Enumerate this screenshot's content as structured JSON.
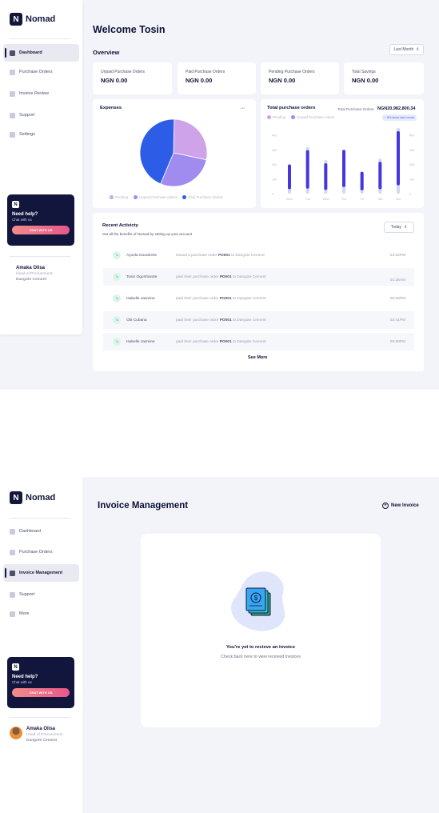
{
  "brand": {
    "name": "Nomad",
    "letter": "N"
  },
  "sidebar1": {
    "items": [
      {
        "label": "Dashboard",
        "active": true
      },
      {
        "label": "Purchase Orders"
      },
      {
        "label": "Invoice Review"
      },
      {
        "label": "Support"
      },
      {
        "label": "Settings"
      }
    ]
  },
  "sidebar2": {
    "items": [
      {
        "label": "Dashboard"
      },
      {
        "label": "Purchase Orders"
      },
      {
        "label": "Invoice Management",
        "active": true
      },
      {
        "label": "Support"
      },
      {
        "label": "More"
      }
    ]
  },
  "help": {
    "letter": "N",
    "title": "Need help?",
    "subtitle": "Chat with us",
    "button": "CHAT WITH US"
  },
  "profile": {
    "name": "Amaka Olisa",
    "role": "Head of Procurement",
    "org": "Dangote Cement"
  },
  "dashboard": {
    "welcome": "Welcome Tosin",
    "overview": "Overview",
    "period": "Last Month",
    "stats": [
      {
        "label": "Unpaid Purchase Orders",
        "value": "NGN 0.00"
      },
      {
        "label": "Paid Purchase Orders",
        "value": "NGN 0.00"
      },
      {
        "label": "Pending Purchase Orders",
        "value": "NGN 0.00"
      },
      {
        "label": "Total Savings",
        "value": "NGN 0.00"
      }
    ],
    "expenses": {
      "title": "Expenses",
      "menu": "•••"
    },
    "totals": {
      "title": "Total purchase orders",
      "sub_label": "Total Purchase Orders",
      "sub_value": "NGN20,982,800.34",
      "badge": "↑ 8% since last month"
    },
    "activity": {
      "title": "Recent Activicty",
      "subtitle": "Get all the benefits of Nomad by setting up your account",
      "filter": "Today",
      "rows": [
        {
          "name": "Ayoola Goodness",
          "pre": "issued a purchase order",
          "code": "PO001",
          "post": "to Dangote Cement",
          "time": "02:52PM"
        },
        {
          "name": "Tosin Ogunfowote",
          "pre": "paid their purchase order",
          "code": "PO001",
          "post": "to Dangote Cement",
          "time": "01:36AM"
        },
        {
          "name": "Isabelle Jasmine",
          "pre": "paid their purchase order",
          "code": "PO001",
          "post": "to Dangote Cement",
          "time": "06:58PM"
        },
        {
          "name": "Obi Cubana",
          "pre": "paid their purchase order",
          "code": "PO001",
          "post": "to Dangote Cement",
          "time": "02:41PM"
        },
        {
          "name": "Isabelle Jasmine",
          "pre": "paid their purchase order",
          "code": "PO001",
          "post": "to Dangote Cement",
          "time": "06:58PM"
        }
      ],
      "see_more": "See More"
    }
  },
  "invoice": {
    "title": "Invoice Management",
    "new_button": "New Invoice",
    "empty_title": "You're yet to recieve an invoice",
    "empty_sub": "Check back here to view received invoices"
  },
  "colors": {
    "pending": "#cfa3ea",
    "unpaid": "#a08bef",
    "paid": "#2d5ce6",
    "bar": "#4636e0",
    "bar_bg": "#d6d5f3"
  },
  "chart_data": [
    {
      "type": "pie",
      "title": "Expenses",
      "labels": [
        "Pending",
        "Unpaid Purchase orders",
        "Paid Purchase Orders"
      ],
      "values": [
        28,
        28,
        44
      ]
    },
    {
      "type": "bar",
      "title": "Total purchase orders",
      "legend": [
        "Pending",
        "Unpaid Purchase orders"
      ],
      "categories": [
        "Mon",
        "Tue",
        "Wed",
        "Thu",
        "Fri",
        "Sat",
        "Sun"
      ],
      "y_ticks": [
        0,
        100,
        200,
        300,
        400
      ],
      "ylim": [
        0,
        400
      ],
      "series": [
        {
          "name": "Pending",
          "values": [
            200,
            320,
            230,
            300,
            150,
            240,
            450
          ]
        },
        {
          "name": "Unpaid Purchase orders",
          "values": [
            200,
            230,
            170,
            300,
            150,
            200,
            380
          ]
        }
      ]
    }
  ]
}
